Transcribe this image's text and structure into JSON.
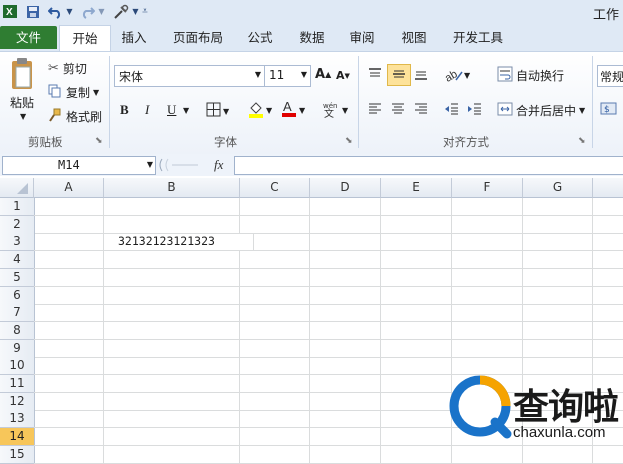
{
  "title": "工作",
  "quick_access": {
    "save_icon": "save-icon",
    "undo_icon": "undo-icon",
    "redo_icon": "redo-icon",
    "customize_icon": "customize-icon"
  },
  "tabs": [
    "文件",
    "开始",
    "插入",
    "页面布局",
    "公式",
    "数据",
    "审阅",
    "视图",
    "开发工具"
  ],
  "active_tab": "开始",
  "ribbon": {
    "clipboard": {
      "paste": "粘贴",
      "cut": "剪切",
      "copy": "复制",
      "format_painter": "格式刷",
      "label": "剪贴板"
    },
    "font": {
      "name": "宋体",
      "size": "11",
      "bold": "B",
      "italic": "I",
      "underline": "U",
      "grow": "A",
      "shrink": "A",
      "label": "字体",
      "fill_color": "#ffff00",
      "font_color": "#e00000"
    },
    "alignment": {
      "wrap_text": "自动换行",
      "merge_center": "合并后居中",
      "label": "对齐方式"
    },
    "number": {
      "format": "常规"
    }
  },
  "formula_bar": {
    "name_box": "M14",
    "fx": "fx",
    "formula": ""
  },
  "sheet": {
    "columns": [
      "A",
      "B",
      "C",
      "D",
      "E",
      "F",
      "G"
    ],
    "rows": [
      "1",
      "2",
      "3",
      "4",
      "5",
      "6",
      "7",
      "8",
      "9",
      "10",
      "11",
      "12",
      "13",
      "14",
      "15"
    ],
    "active_row": "14",
    "cells": {
      "B3": "32132123121323"
    }
  },
  "watermark": {
    "brand": "查询啦",
    "url": "chaxunla.com"
  }
}
